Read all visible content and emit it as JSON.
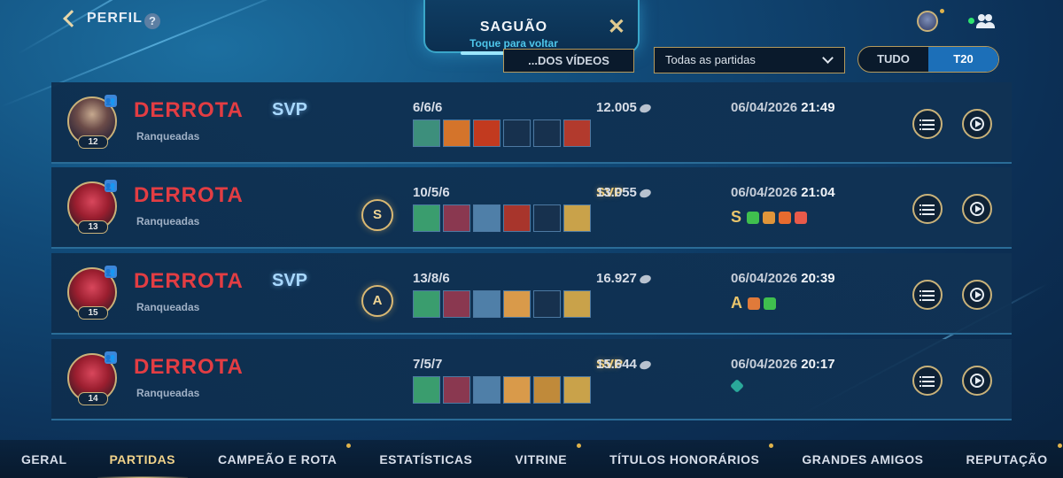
{
  "header": {
    "back_label": "PERFIL",
    "help_icon": "?",
    "lobby_title": "SAGUÃO",
    "lobby_subtitle": "Toque para voltar",
    "close_icon": "✕",
    "videos_label": "...DOS VÍDEOS",
    "filter_value": "Todas as partidas",
    "segment": {
      "left": "TUDO",
      "right": "T20",
      "selected": "T20"
    }
  },
  "matches": [
    {
      "result": "DERROTA",
      "mode": "Ranqueadas",
      "award": "SVP",
      "award_color": "blue",
      "level": "12",
      "medal": "",
      "kda": "6/6/6",
      "gold": "12.005",
      "date": "06/04/2026",
      "time": "21:49",
      "badge_letter": "",
      "items": [
        "#3d8f7c",
        "#d4742b",
        "#c23a1f",
        "#17314e",
        "#17314e",
        "#b23a2d"
      ]
    },
    {
      "result": "DERROTA",
      "mode": "Ranqueadas",
      "award": "SVP",
      "award_color": "gold",
      "level": "13",
      "medal": "S",
      "kda": "10/5/6",
      "gold": "13.055",
      "date": "06/04/2026",
      "time": "21:04",
      "badge_letter": "S",
      "items": [
        "#3a9d6e",
        "#8a3850",
        "#4f7fa8",
        "#a8352c",
        "#17314e",
        "#c9a24a"
      ]
    },
    {
      "result": "DERROTA",
      "mode": "Ranqueadas",
      "award": "SVP",
      "award_color": "blue",
      "level": "15",
      "medal": "A",
      "kda": "13/8/6",
      "gold": "16.927",
      "date": "06/04/2026",
      "time": "20:39",
      "badge_letter": "A",
      "items": [
        "#3a9d6e",
        "#8a3850",
        "#4f7fa8",
        "#d99a4a",
        "#17314e",
        "#c9a24a"
      ]
    },
    {
      "result": "DERROTA",
      "mode": "Ranqueadas",
      "award": "SVP",
      "award_color": "gold",
      "level": "14",
      "medal": "",
      "kda": "7/5/7",
      "gold": "15.644",
      "date": "06/04/2026",
      "time": "20:17",
      "badge_letter": "",
      "items": [
        "#3a9d6e",
        "#8a3850",
        "#4f7fa8",
        "#d99a4a",
        "#c08a3a",
        "#c9a24a"
      ]
    }
  ],
  "tabs": [
    {
      "label": "GERAL",
      "active": false,
      "dot": false
    },
    {
      "label": "PARTIDAS",
      "active": true,
      "dot": false
    },
    {
      "label": "CAMPEÃO E ROTA",
      "active": false,
      "dot": true
    },
    {
      "label": "ESTATÍSTICAS",
      "active": false,
      "dot": false
    },
    {
      "label": "VITRINE",
      "active": false,
      "dot": true
    },
    {
      "label": "TÍTULOS HONORÁRIOS",
      "active": false,
      "dot": true
    },
    {
      "label": "GRANDES AMIGOS",
      "active": false,
      "dot": false
    },
    {
      "label": "REPUTAÇÃO",
      "active": false,
      "dot": true
    }
  ]
}
